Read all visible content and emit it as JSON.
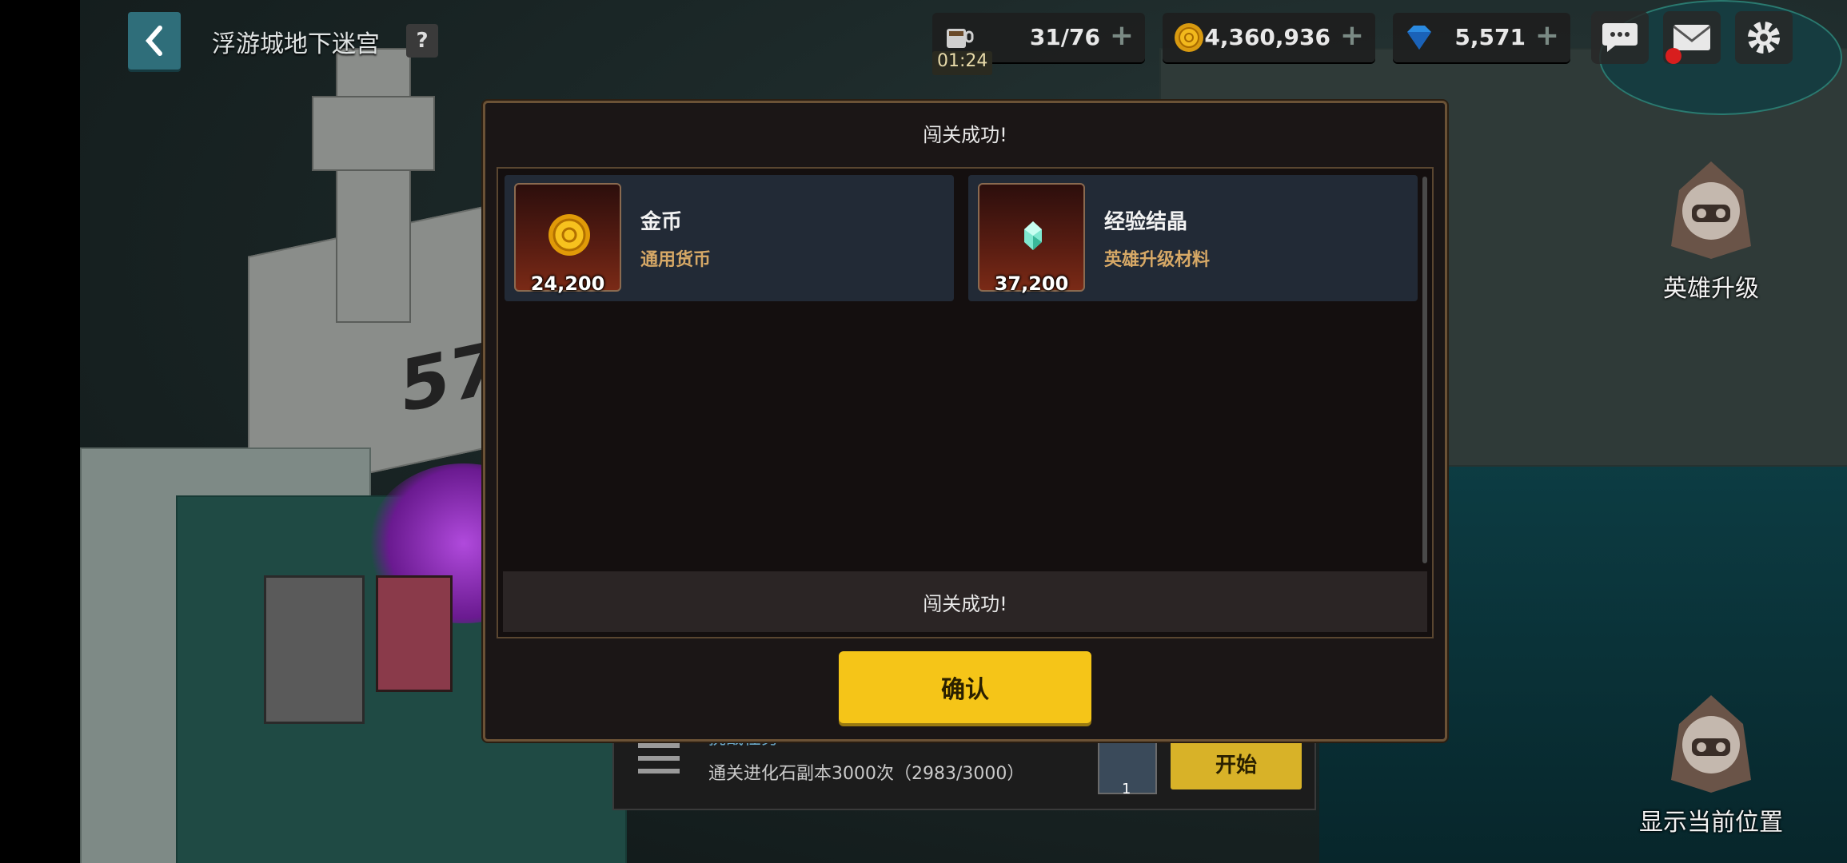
{
  "header": {
    "title": "浮游城地下迷宫",
    "help_label": "?"
  },
  "resources": {
    "stamina": {
      "value": "31/76",
      "timer": "01:24",
      "plus": "+"
    },
    "gold": {
      "value": "4,360,936",
      "plus": "+"
    },
    "gems": {
      "value": "5,571",
      "plus": "+"
    }
  },
  "side_buttons": {
    "hero_upgrade": "英雄升级",
    "show_position": "显示当前位置"
  },
  "quest": {
    "subtitle": "挑战任务",
    "description": "通关进化石副本3000次（2983/3000）",
    "chest_count": "1",
    "start_label": "开始"
  },
  "modal": {
    "title": "闯关成功!",
    "footer_text": "闯关成功!",
    "confirm_label": "确认",
    "rewards": [
      {
        "name": "金币",
        "desc": "通用货币",
        "amount": "24,200",
        "icon": "gold-coin-icon"
      },
      {
        "name": "经验结晶",
        "desc": "英雄升级材料",
        "amount": "37,200",
        "icon": "exp-crystal-icon"
      }
    ]
  },
  "scene": {
    "floor_number": "57"
  },
  "colors": {
    "confirm": "#f5c518",
    "modal_border": "#6b5236",
    "reward_desc": "#d6a866"
  }
}
